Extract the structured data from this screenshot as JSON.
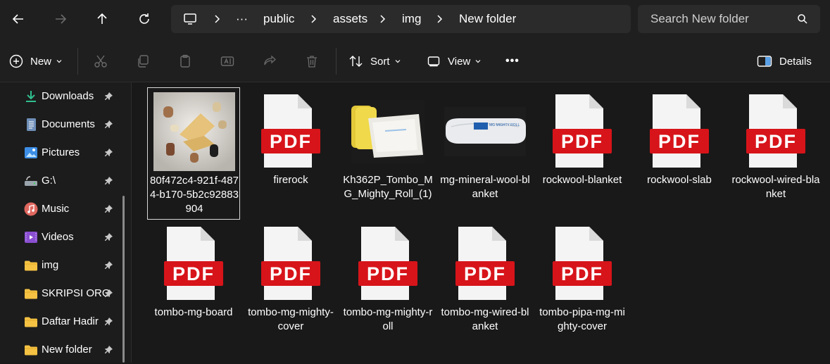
{
  "nav": {
    "breadcrumbs": [
      "public",
      "assets",
      "img",
      "New folder"
    ],
    "overflow_label": "···"
  },
  "search": {
    "placeholder": "Search New folder"
  },
  "toolbar": {
    "new_label": "New",
    "sort_label": "Sort",
    "view_label": "View",
    "more_label": "•••",
    "details_label": "Details"
  },
  "sidebar": {
    "items": [
      {
        "label": "Downloads",
        "icon": "download-icon"
      },
      {
        "label": "Documents",
        "icon": "documents-icon"
      },
      {
        "label": "Pictures",
        "icon": "pictures-icon"
      },
      {
        "label": "G:\\",
        "icon": "drive-icon"
      },
      {
        "label": "Music",
        "icon": "music-icon"
      },
      {
        "label": "Videos",
        "icon": "videos-icon"
      },
      {
        "label": "img",
        "icon": "folder-icon"
      },
      {
        "label": "SKRIPSI ORG",
        "icon": "folder-icon"
      },
      {
        "label": "Daftar Hadir",
        "icon": "folder-icon"
      },
      {
        "label": "New folder",
        "icon": "folder-icon"
      }
    ]
  },
  "files": [
    {
      "name": "80f472c4-921f-4874-b170-5b2c92883904",
      "kind": "image",
      "selected": true
    },
    {
      "name": "firerock",
      "kind": "pdf",
      "badge": "PDF"
    },
    {
      "name": "Kh362P_Tombo_MG_Mighty_Roll_(1)",
      "kind": "image"
    },
    {
      "name": "mg-mineral-wool-blanket",
      "kind": "image",
      "label_on_roll": "MG MIGHTY ROLL"
    },
    {
      "name": "rockwool-blanket",
      "kind": "pdf",
      "badge": "PDF"
    },
    {
      "name": "rockwool-slab",
      "kind": "pdf",
      "badge": "PDF"
    },
    {
      "name": "rockwool-wired-blanket",
      "kind": "pdf",
      "badge": "PDF"
    },
    {
      "name": "tombo-mg-board",
      "kind": "pdf",
      "badge": "PDF"
    },
    {
      "name": "tombo-mg-mighty-cover",
      "kind": "pdf",
      "badge": "PDF"
    },
    {
      "name": "tombo-mg-mighty-roll",
      "kind": "pdf",
      "badge": "PDF"
    },
    {
      "name": "tombo-mg-wired-blanket",
      "kind": "pdf",
      "badge": "PDF"
    },
    {
      "name": "tombo-pipa-mg-mighty-cover",
      "kind": "pdf",
      "badge": "PDF"
    }
  ],
  "colors": {
    "pdf_red": "#d7141a",
    "folder_yellow": "#f5c243",
    "background": "#191919"
  }
}
